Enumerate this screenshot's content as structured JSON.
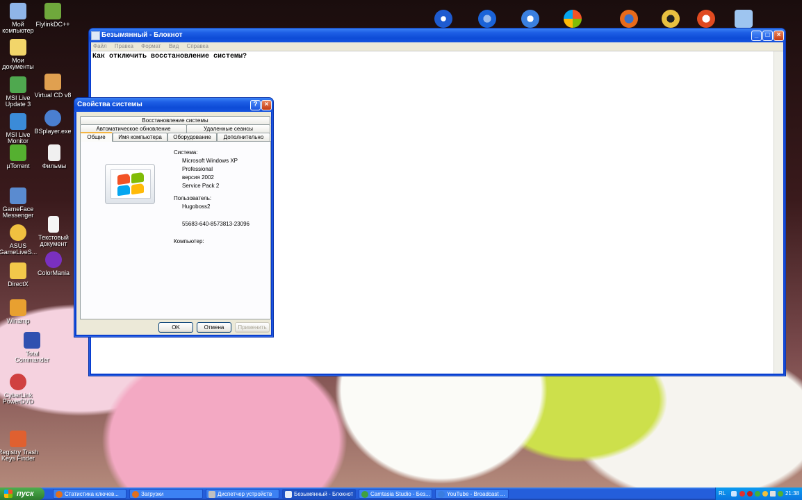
{
  "desktop_icons": [
    {
      "label": "Мой компьютер",
      "color": "#8fb5e8"
    },
    {
      "label": "FlylinkDC++",
      "color": "#6fa83c"
    },
    {
      "label": "Мои документы",
      "color": "#f2d56a"
    },
    {
      "label": "Virtual CD v8",
      "color": "#e0a050"
    },
    {
      "label": "MSI Live Update 3",
      "color": "#4fa84f"
    },
    {
      "label": "BSplayer.exe",
      "color": "#4a7fd0"
    },
    {
      "label": "MSI Live Monitor",
      "color": "#3b8bd8"
    },
    {
      "label": "µTorrent",
      "color": "#55b030"
    },
    {
      "label": "Фильмы",
      "color": "#f0f0f0"
    },
    {
      "label": "GameFace Messenger",
      "color": "#5a8bd0"
    },
    {
      "label": "ASUS GameLiveS...",
      "color": "#f0c040"
    },
    {
      "label": "Текстовый документ",
      "color": "#f5f5f5"
    },
    {
      "label": "ColorMania",
      "color": "#7a30c0"
    },
    {
      "label": "DirectX",
      "color": "#f2c84a"
    },
    {
      "label": "Winamp",
      "color": "#e8a030"
    },
    {
      "label": "Total Commander",
      "color": "#3050b0"
    },
    {
      "label": "CyberLink PowerDVD",
      "color": "#d04040"
    },
    {
      "label": "Registry Trash Keys Finder",
      "color": "#e06030"
    }
  ],
  "top_icon_partial": "Mozilla Firefox",
  "notepad": {
    "title": "Безымянный - Блокнот",
    "menu": [
      "Файл",
      "Правка",
      "Формат",
      "Вид",
      "Справка"
    ],
    "content": "Как отключить восстановление системы?"
  },
  "dialog": {
    "title": "Свойства системы",
    "tabs_row1": [
      "Восстановление системы"
    ],
    "tabs_row2": [
      "Автоматическое обновление",
      "Удаленные сеансы"
    ],
    "tabs_row3": [
      "Общие",
      "Имя компьютера",
      "Оборудование",
      "Дополнительно"
    ],
    "system_label": "Система:",
    "system_lines": [
      "Microsoft Windows XP",
      "Professional",
      "версия 2002",
      "Service Pack 2"
    ],
    "user_label": "Пользователь:",
    "user_name": "Hugoboss2",
    "product_id": "55683-640-8573813-23096",
    "computer_label": "Компьютер:",
    "ok": "OK",
    "cancel": "Отмена",
    "apply": "Применить"
  },
  "taskbar": {
    "start": "пуск",
    "tasks": [
      {
        "label": "Статистика ключев...",
        "icon_color": "#e07020"
      },
      {
        "label": "Загрузки",
        "icon_color": "#e07020"
      },
      {
        "label": "Диспетчер устройств",
        "icon_color": "#c0c0c0"
      },
      {
        "label": "Безымянный - Блокнот",
        "icon_color": "#e8eef8"
      },
      {
        "label": "Camtasia Studio - Без...",
        "icon_color": "#40a040"
      },
      {
        "label": "YouTube - Broadcast ...",
        "icon_color": "#3a7de0"
      }
    ],
    "lang": "RL",
    "clock": "21:38"
  }
}
